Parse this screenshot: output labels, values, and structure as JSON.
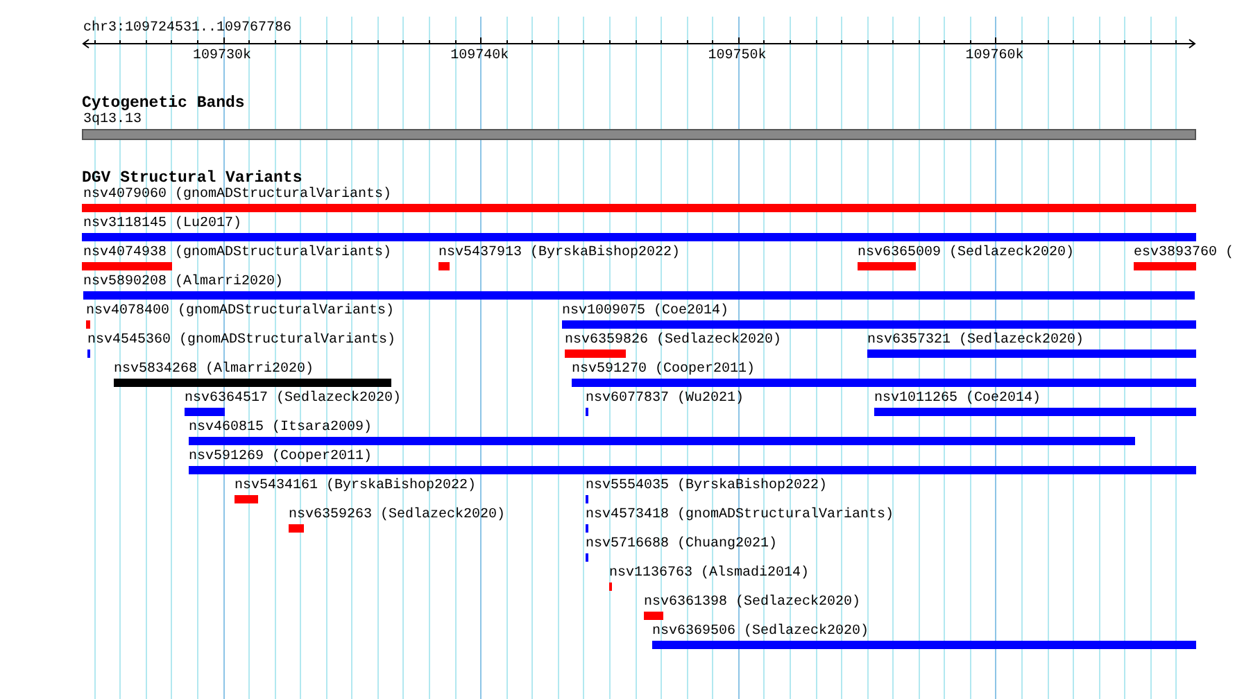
{
  "position": "chr3:109724531..109767786",
  "ruler": {
    "ticks": [
      "109730k",
      "109740k",
      "109750k",
      "109760k"
    ]
  },
  "tracks": [
    {
      "kind": "band",
      "title": "Cytogenetic Bands",
      "band": {
        "label": "3q13.13"
      }
    },
    {
      "kind": "features",
      "title": "DGV Structural Variants",
      "rows": [
        [
          {
            "label": "nsv4079060 (gnomADStructuralVariants)",
            "color": "#ff0000"
          }
        ],
        [
          {
            "label": "nsv3118145 (Lu2017)",
            "color": "#0000ff"
          }
        ],
        [
          {
            "label": "nsv4074938 (gnomADStructuralVariants)",
            "color": "#ff0000"
          },
          {
            "label": "nsv5437913 (ByrskaBishop2022)",
            "color": "#ff0000"
          },
          {
            "label": "nsv6365009 (Sedlazeck2020)",
            "color": "#ff0000"
          },
          {
            "label": "esv3893760 (",
            "color": "#ff0000"
          }
        ],
        [
          {
            "label": "nsv5890208 (Almarri2020)",
            "color": "#0000ff"
          }
        ],
        [
          {
            "label": "nsv4078400 (gnomADStructuralVariants)",
            "color": "#ff0000"
          },
          {
            "label": "nsv1009075 (Coe2014)",
            "color": "#0000ff"
          }
        ],
        [
          {
            "label": "nsv4545360 (gnomADStructuralVariants)",
            "color": "#0000ff"
          },
          {
            "label": "nsv6359826 (Sedlazeck2020)",
            "color": "#ff0000"
          },
          {
            "label": "nsv6357321 (Sedlazeck2020)",
            "color": "#0000ff"
          }
        ],
        [
          {
            "label": "nsv5834268 (Almarri2020)",
            "color": "#000000"
          },
          {
            "label": "nsv591270 (Cooper2011)",
            "color": "#0000ff"
          }
        ],
        [
          {
            "label": "nsv6364517 (Sedlazeck2020)",
            "color": "#0000ff"
          },
          {
            "label": "nsv6077837 (Wu2021)",
            "color": "#0000ff"
          },
          {
            "label": "nsv1011265 (Coe2014)",
            "color": "#0000ff"
          }
        ],
        [
          {
            "label": "nsv460815 (Itsara2009)",
            "color": "#0000ff"
          }
        ],
        [
          {
            "label": "nsv591269 (Cooper2011)",
            "color": "#0000ff"
          }
        ],
        [
          {
            "label": "nsv5434161 (ByrskaBishop2022)",
            "color": "#ff0000"
          },
          {
            "label": "nsv5554035 (ByrskaBishop2022)",
            "color": "#0000ff"
          }
        ],
        [
          {
            "label": "nsv6359263 (Sedlazeck2020)",
            "color": "#ff0000"
          },
          {
            "label": "nsv4573418 (gnomADStructuralVariants)",
            "color": "#0000ff"
          }
        ],
        [
          {
            "label": "nsv5716688 (Chuang2021)",
            "color": "#0000ff"
          }
        ],
        [
          {
            "label": "nsv1136763 (Alsmadi2014)",
            "color": "#ff0000"
          }
        ],
        [
          {
            "label": "nsv6361398 (Sedlazeck2020)",
            "color": "#ff0000"
          }
        ],
        [
          {
            "label": "nsv6369506 (Sedlazeck2020)",
            "color": "#0000ff"
          }
        ]
      ]
    }
  ]
}
